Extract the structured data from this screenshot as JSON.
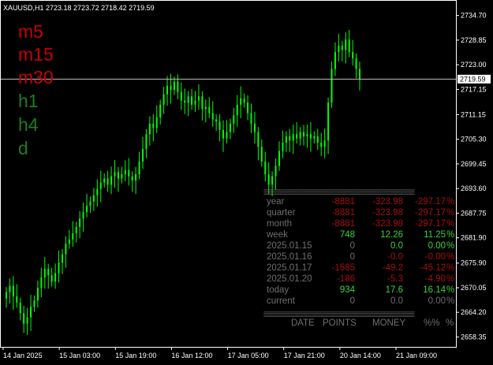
{
  "title": "XAUUSD,H1  2723.18 2723.72 2718.42 2719.59",
  "timeframes": [
    {
      "label": "m5",
      "color": "#c80000"
    },
    {
      "label": "m15",
      "color": "#c80000"
    },
    {
      "label": "m30",
      "color": "#c80000"
    },
    {
      "label": "h1",
      "color": "#1e7d1e"
    },
    {
      "label": "h4",
      "color": "#1e7d1e"
    },
    {
      "label": "d",
      "color": "#1e7d1e"
    }
  ],
  "colors": {
    "background": "#000000",
    "candle": "#00ff00",
    "axis": "#ffffff",
    "bid_line": "#c0c0c0",
    "bid_label_bg": "#ffffff",
    "negative": "#a40f0f",
    "positive": "#39d139",
    "muted": "#6e6e6e",
    "timeframe_red": "#c80000",
    "timeframe_green": "#1e7d1e"
  },
  "price_axis": {
    "ticks": [
      "2734.70",
      "2728.85",
      "2723.00",
      "2717.15",
      "2711.15",
      "2705.30",
      "2699.45",
      "2693.60",
      "2687.75",
      "2681.90",
      "2675.90",
      "2670.05",
      "2664.20",
      "2658.35"
    ],
    "bid_label": "2719.59",
    "range": [
      2656.0,
      2738.0
    ]
  },
  "time_axis": {
    "labels": [
      "14 Jan 2025",
      "15 Jan 03:00",
      "15 Jan 19:00",
      "16 Jan 12:00",
      "17 Jan 05:00",
      "17 Jan 21:00",
      "20 Jan 14:00",
      "21 Jan 09:00"
    ]
  },
  "stats": {
    "rows": [
      {
        "label": "year",
        "points": "-8881",
        "money": "-323.98",
        "percent": "-297.17",
        "sign": "%"
      },
      {
        "label": "quarter",
        "points": "-8881",
        "money": "-323.98",
        "percent": "-297.17",
        "sign": "%"
      },
      {
        "label": "month",
        "points": "-8881",
        "money": "-323.98",
        "percent": "-297.17",
        "sign": "%"
      },
      {
        "label": "week",
        "points": "748",
        "money": "12.26",
        "percent": "11.25",
        "sign": "%"
      },
      {
        "label": "2025.01.15",
        "points": "0",
        "money": "0.0",
        "percent": "0.00",
        "sign": "%"
      },
      {
        "label": "2025.01.16",
        "points": "0",
        "money": "-0.0",
        "percent": "-0.00",
        "sign": "%"
      },
      {
        "label": "2025.01.17",
        "points": "-1585",
        "money": "-49.2",
        "percent": "-45.12",
        "sign": "%"
      },
      {
        "label": "2025.01.20",
        "points": "-186",
        "money": "-5.3",
        "percent": "-4.90",
        "sign": "%"
      },
      {
        "label": "today",
        "points": "934",
        "money": "17.6",
        "percent": "16.14",
        "sign": "%"
      },
      {
        "label": "current",
        "points": "0",
        "money": "0.0",
        "percent": "0.00",
        "sign": "%"
      }
    ],
    "footer": {
      "date": "DATE",
      "points": "POINTS",
      "money": "MONEY",
      "pct": "%%",
      "sign": "%"
    },
    "separator": "=================================================="
  },
  "chart_data": {
    "type": "candlestick",
    "symbol": "XAUUSD",
    "timeframe": "H1",
    "ohlc_last": {
      "open": 2723.18,
      "high": 2723.72,
      "low": 2718.42,
      "close": 2719.59
    },
    "closes": [
      2669.0,
      2670.5,
      2668.0,
      2666.5,
      2664.0,
      2661.5,
      2663.0,
      2665.5,
      2667.0,
      2670.0,
      2672.5,
      2674.5,
      2673.0,
      2671.5,
      2673.5,
      2676.0,
      2678.0,
      2680.5,
      2681.5,
      2683.0,
      2684.5,
      2686.5,
      2688.0,
      2689.5,
      2690.5,
      2692.0,
      2693.5,
      2695.0,
      2696.0,
      2694.5,
      2696.5,
      2697.5,
      2696.0,
      2697.0,
      2698.0,
      2696.5,
      2695.5,
      2697.0,
      2700.0,
      2703.0,
      2706.5,
      2709.0,
      2708.0,
      2710.5,
      2713.5,
      2716.0,
      2718.0,
      2717.0,
      2719.0,
      2716.5,
      2714.5,
      2714.0,
      2715.5,
      2713.5,
      2714.5,
      2715.5,
      2712.5,
      2713.0,
      2711.5,
      2710.0,
      2709.5,
      2707.5,
      2705.5,
      2707.0,
      2709.0,
      2711.0,
      2713.5,
      2715.0,
      2714.0,
      2711.5,
      2709.0,
      2707.0,
      2703.5,
      2700.0,
      2697.0,
      2694.5,
      2696.5,
      2699.0,
      2702.5,
      2704.5,
      2706.0,
      2705.0,
      2706.5,
      2705.5,
      2707.0,
      2706.0,
      2706.5,
      2705.5,
      2706.0,
      2704.5,
      2703.5,
      2705.0,
      2714.0,
      2722.0,
      2726.0,
      2727.5,
      2726.5,
      2729.0,
      2726.0,
      2724.5,
      2722.0,
      2719.59
    ]
  }
}
